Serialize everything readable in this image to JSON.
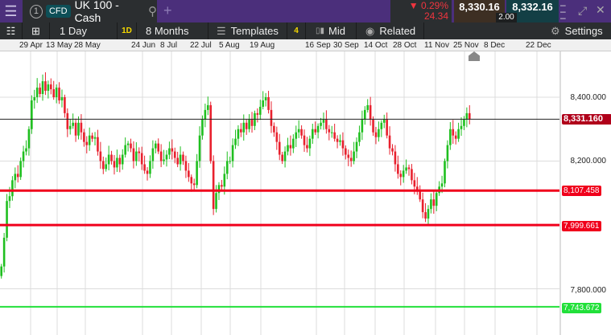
{
  "header": {
    "instrument_number": "1",
    "product_badge": "CFD",
    "instrument": "UK 100 - Cash",
    "change_pct": "0.29%",
    "change_abs": "24.34",
    "bid": "8,330.16",
    "ask": "8,332.16",
    "spread": "2.00"
  },
  "toolbar": {
    "interval": "1 Day",
    "interval_badge": "1D",
    "range": "8 Months",
    "templates": "Templates",
    "templates_count": "4",
    "price_type": "Mid",
    "related": "Related",
    "settings": "Settings"
  },
  "dates": [
    "29 Apr",
    "13 May",
    "28 May",
    "24 Jun",
    "8 Jul",
    "22 Jul",
    "5 Aug",
    "19 Aug",
    "16 Sep",
    "30 Sep",
    "14 Oct",
    "28 Oct",
    "11 Nov",
    "25 Nov",
    "8 Dec",
    "22 Dec"
  ],
  "price_axis": [
    "8,400.000",
    "8,200.000",
    "7,800.000"
  ],
  "levels": {
    "current": "8,331.160",
    "red1": "8,107.458",
    "red2": "7,999.661",
    "green": "7,743.672"
  },
  "colors": {
    "up": "#1fbf1f",
    "down": "#e8212e",
    "level_red": "#f0001c",
    "level_green": "#22e03a",
    "current_tag": "#b0001a"
  },
  "chart_data": {
    "type": "candlestick",
    "ylim": [
      7720,
      8530
    ],
    "closes": [
      7870,
      7960,
      8075,
      8090,
      8140,
      8160,
      8150,
      8200,
      8230,
      8240,
      8300,
      8390,
      8400,
      8430,
      8410,
      8450,
      8420,
      8440,
      8425,
      8400,
      8430,
      8390,
      8400,
      8350,
      8300,
      8310,
      8320,
      8280,
      8320,
      8290,
      8260,
      8250,
      8280,
      8270,
      8275,
      8230,
      8200,
      8175,
      8190,
      8220,
      8200,
      8180,
      8210,
      8190,
      8220,
      8250,
      8255,
      8240,
      8200,
      8230,
      8225,
      8190,
      8170,
      8160,
      8200,
      8240,
      8255,
      8230,
      8200,
      8205,
      8220,
      8240,
      8230,
      8210,
      8190,
      8220,
      8200,
      8170,
      8150,
      8130,
      8125,
      8200,
      8280,
      8330,
      8360,
      8375,
      8200,
      8050,
      8100,
      8125,
      8120,
      8160,
      8200,
      8200,
      8250,
      8270,
      8300,
      8290,
      8320,
      8300,
      8330,
      8310,
      8350,
      8345,
      8370,
      8390,
      8400,
      8360,
      8310,
      8290,
      8260,
      8220,
      8200,
      8230,
      8250,
      8240,
      8270,
      8290,
      8300,
      8280,
      8250,
      8240,
      8270,
      8300,
      8290,
      8310,
      8320,
      8330,
      8300,
      8290,
      8290,
      8270,
      8260,
      8265,
      8240,
      8220,
      8210,
      8200,
      8230,
      8260,
      8290,
      8330,
      8360,
      8375,
      8330,
      8290,
      8275,
      8300,
      8320,
      8330,
      8280,
      8240,
      8230,
      8190,
      8160,
      8150,
      8170,
      8180,
      8175,
      8140,
      8120,
      8110,
      8080,
      8040,
      8020,
      8050,
      8080,
      8060,
      8100,
      8120,
      8130,
      8200,
      8250,
      8300,
      8280,
      8270,
      8300,
      8310,
      8330,
      8350,
      8331
    ]
  }
}
